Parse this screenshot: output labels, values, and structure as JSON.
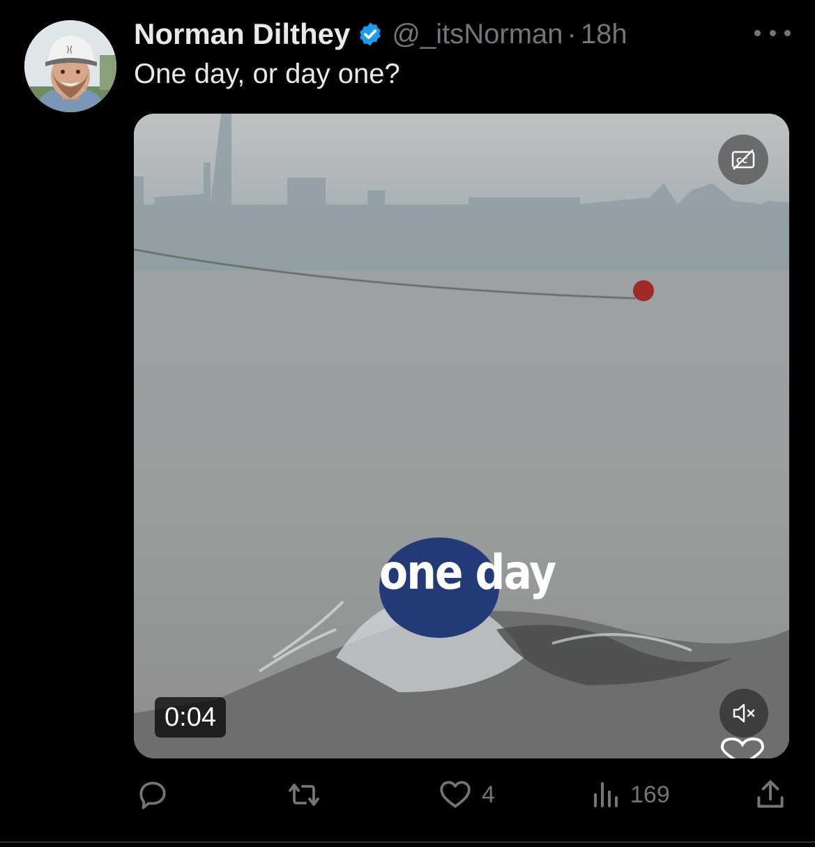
{
  "tweet": {
    "author_name": "Norman Dilthey",
    "handle": "@_itsNorman",
    "separator": "·",
    "time": "18h",
    "text": "One day, or day one?"
  },
  "media": {
    "caption": "one day",
    "duration": "0:04",
    "captions_icon": "captions-off-icon",
    "sound_icon": "volume-muted-icon"
  },
  "actions": {
    "reply_count": "",
    "retweet_count": "",
    "like_count": "4",
    "views_count": "169"
  },
  "colors": {
    "background": "#000000",
    "text_primary": "#e7e9ea",
    "text_secondary": "#71767b",
    "verified": "#1d9bf0"
  }
}
